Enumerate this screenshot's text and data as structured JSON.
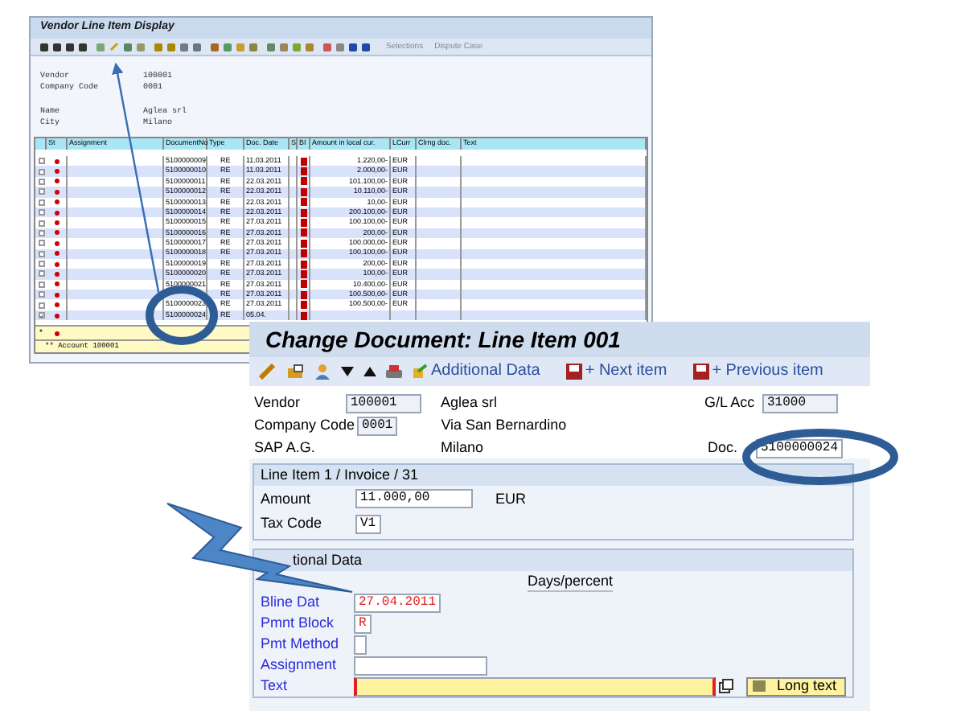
{
  "back_window": {
    "title": "Vendor Line Item Display",
    "toolbar_buttons": [
      {
        "label": "Selections",
        "disabled": true
      },
      {
        "label": "Dispute Case",
        "disabled": true
      }
    ],
    "header_fields": [
      {
        "label": "Vendor",
        "value": "100001"
      },
      {
        "label": "Company Code",
        "value": "0001"
      },
      {
        "label": "Name",
        "value": "Aglea srl"
      },
      {
        "label": "City",
        "value": "Milano"
      }
    ],
    "table": {
      "columns": [
        "St",
        "Assignment",
        "DocumentNo",
        "Type",
        "Doc. Date",
        "S",
        "BI",
        "Amount in local cur.",
        "LCurr",
        "Clrng doc.",
        "Text"
      ],
      "rows": [
        {
          "checked": false,
          "document_no": "5100000009",
          "type": "RE",
          "doc_date": "11.03.2011",
          "amount": "1.220,00-",
          "currency": "EUR"
        },
        {
          "checked": false,
          "document_no": "5100000010",
          "type": "RE",
          "doc_date": "11.03.2011",
          "amount": "2.000,00-",
          "currency": "EUR"
        },
        {
          "checked": false,
          "document_no": "5100000011",
          "type": "RE",
          "doc_date": "22.03.2011",
          "amount": "101.100,00-",
          "currency": "EUR"
        },
        {
          "checked": false,
          "document_no": "5100000012",
          "type": "RE",
          "doc_date": "22.03.2011",
          "amount": "10.110,00-",
          "currency": "EUR"
        },
        {
          "checked": false,
          "document_no": "5100000013",
          "type": "RE",
          "doc_date": "22.03.2011",
          "amount": "10,00-",
          "currency": "EUR"
        },
        {
          "checked": false,
          "document_no": "5100000014",
          "type": "RE",
          "doc_date": "22.03.2011",
          "amount": "200.100,00-",
          "currency": "EUR"
        },
        {
          "checked": false,
          "document_no": "5100000015",
          "type": "RE",
          "doc_date": "27.03.2011",
          "amount": "100.100,00-",
          "currency": "EUR"
        },
        {
          "checked": false,
          "document_no": "5100000016",
          "type": "RE",
          "doc_date": "27.03.2011",
          "amount": "200,00-",
          "currency": "EUR"
        },
        {
          "checked": false,
          "document_no": "5100000017",
          "type": "RE",
          "doc_date": "27.03.2011",
          "amount": "100.000,00-",
          "currency": "EUR"
        },
        {
          "checked": false,
          "document_no": "5100000018",
          "type": "RE",
          "doc_date": "27.03.2011",
          "amount": "100.100,00-",
          "currency": "EUR"
        },
        {
          "checked": false,
          "document_no": "5100000019",
          "type": "RE",
          "doc_date": "27.03.2011",
          "amount": "200,00-",
          "currency": "EUR"
        },
        {
          "checked": false,
          "document_no": "5100000020",
          "type": "RE",
          "doc_date": "27.03.2011",
          "amount": "100,00-",
          "currency": "EUR"
        },
        {
          "checked": false,
          "document_no": "5100000021",
          "type": "RE",
          "doc_date": "27.03.2011",
          "amount": "10.400,00-",
          "currency": "EUR"
        },
        {
          "checked": false,
          "type": "RE",
          "doc_date": "27.03.2011",
          "amount": "100.500,00-",
          "currency": "EUR"
        },
        {
          "checked": false,
          "document_no": "5100000023",
          "type": "RE",
          "doc_date": "27.03.2011",
          "amount": "100.500,00-",
          "currency": "EUR"
        },
        {
          "checked": true,
          "document_no": "5100000024",
          "type": "RE",
          "doc_date": "05.04."
        }
      ]
    },
    "entry_row_marker": "*",
    "status": "** Account 100001"
  },
  "front_window": {
    "title": "Change Document: Line Item 001",
    "toolbar_buttons": [
      "Additional Data",
      "+ Next item",
      "+ Previous item"
    ],
    "vendor": {
      "label": "Vendor",
      "value": "100001"
    },
    "vendor_name": "Aglea srl",
    "gl_account": {
      "label": "G/L Acc",
      "value": "31000"
    },
    "company_code": {
      "label": "Company Code",
      "value": "0001"
    },
    "street": "Via San Bernardino",
    "company_name": "SAP A.G.",
    "city": "Milano",
    "doc_no": {
      "label": "Doc.",
      "value": "5100000024"
    },
    "line_item": {
      "title": "Line Item 1 / Invoice / 31",
      "amount": {
        "label": "Amount",
        "value": "11.000,00",
        "currency": "EUR"
      },
      "tax_code": {
        "label": "Tax Code",
        "value": "V1"
      }
    },
    "additional_data": {
      "title": "tional Data",
      "column_heading": "Days/percent",
      "fields": [
        {
          "label": "Bline Dat",
          "value": "27.04.2011",
          "highlighted": true,
          "required": false
        },
        {
          "label": "Pmnt Block",
          "value": "R",
          "highlighted": true,
          "required": false
        },
        {
          "label": "Pmt Method",
          "required": false
        },
        {
          "label": "Assignment",
          "required": false
        },
        {
          "label": "Text",
          "required": true
        }
      ],
      "long_text_button": "Long text"
    }
  }
}
